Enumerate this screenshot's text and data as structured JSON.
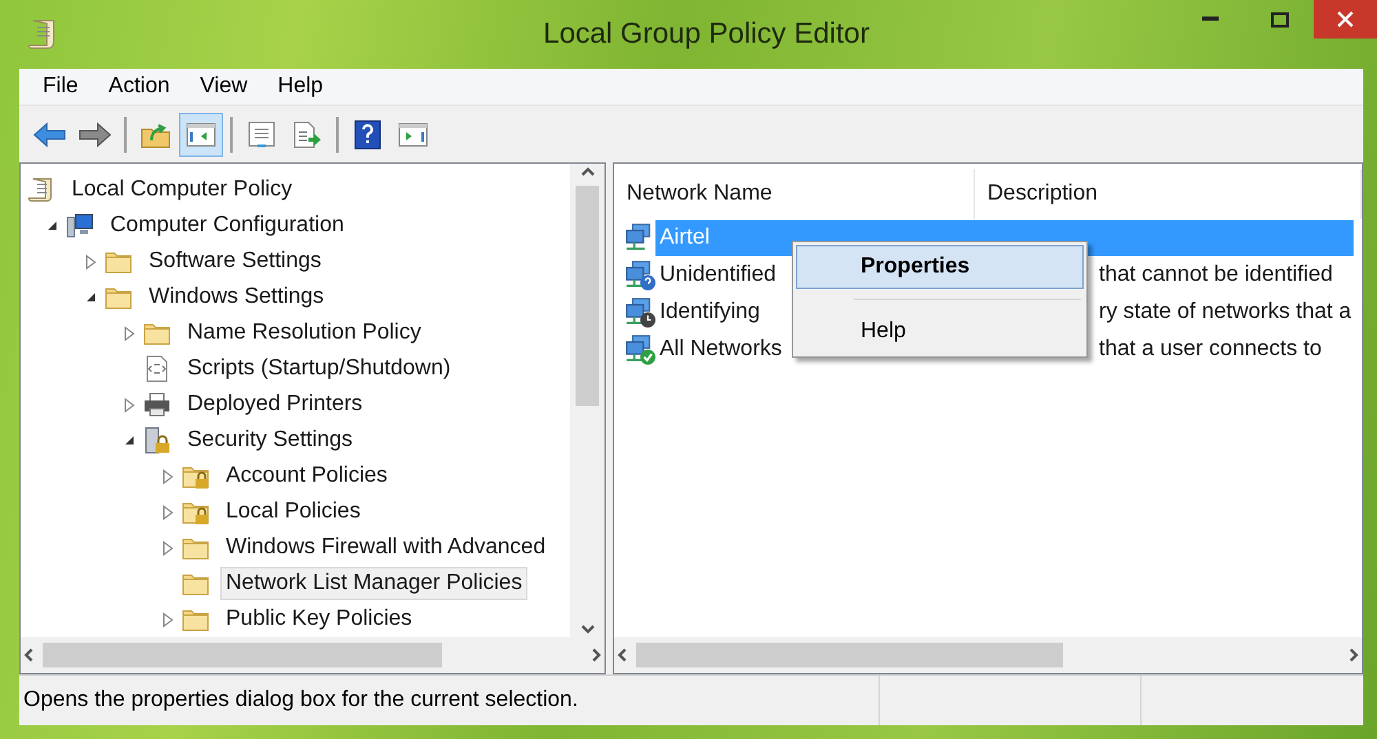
{
  "window": {
    "title": "Local Group Policy Editor"
  },
  "menu": [
    "File",
    "Action",
    "View",
    "Help"
  ],
  "toolbar": [
    [
      {
        "pressed": false
      },
      {
        "pressed": false
      }
    ],
    [
      {
        "pressed": false
      },
      {
        "pressed": true
      }
    ],
    [
      {
        "pressed": false
      },
      {
        "pressed": false
      }
    ],
    [
      {
        "pressed": false
      },
      {
        "pressed": false
      }
    ]
  ],
  "tree": [
    {
      "label": "Local Computer Policy",
      "kind": "scroll",
      "selected": false,
      "children": [
        {
          "label": "Computer Configuration",
          "kind": "computer",
          "expanded": true,
          "selected": false,
          "children": [
            {
              "label": "Software Settings",
              "kind": "folder",
              "expanded": false,
              "selected": false
            },
            {
              "label": "Windows Settings",
              "kind": "folder",
              "expanded": true,
              "selected": false,
              "children": [
                {
                  "label": "Name Resolution Policy",
                  "kind": "folder",
                  "expanded": false,
                  "selected": false
                },
                {
                  "label": "Scripts (Startup/Shutdown)",
                  "kind": "script",
                  "selected": false
                },
                {
                  "label": "Deployed Printers",
                  "kind": "printer",
                  "expanded": false,
                  "selected": false
                },
                {
                  "label": "Security Settings",
                  "kind": "security",
                  "expanded": true,
                  "selected": false,
                  "children": [
                    {
                      "label": "Account Policies",
                      "kind": "locked-folder",
                      "expanded": false,
                      "selected": false
                    },
                    {
                      "label": "Local Policies",
                      "kind": "locked-folder",
                      "expanded": false,
                      "selected": false
                    },
                    {
                      "label": "Windows Firewall with Advanced",
                      "kind": "folder",
                      "expanded": false,
                      "selected": false
                    },
                    {
                      "label": "Network List Manager Policies",
                      "kind": "folder",
                      "selected": true
                    },
                    {
                      "label": "Public Key Policies",
                      "kind": "folder",
                      "expanded": false,
                      "selected": false
                    }
                  ]
                }
              ]
            }
          ]
        }
      ]
    }
  ],
  "list": {
    "columns": [
      "Network Name",
      "Description"
    ],
    "rows": [
      {
        "name": "Airtel",
        "kind": "plain",
        "selected": true
      },
      {
        "name": "Unidentified",
        "description": "that cannot be identified",
        "kind": "unknown",
        "selected": false,
        "covered": true
      },
      {
        "name": "Identifying",
        "description": "ry state of networks that a",
        "kind": "pending",
        "selected": false,
        "covered": true
      },
      {
        "name": "All Networks",
        "description": "that a user connects to",
        "kind": "ok",
        "selected": false,
        "covered": true
      }
    ]
  },
  "context_menu": [
    {
      "label": "Properties",
      "default": true,
      "highlighted": true
    },
    {
      "label": "Help",
      "default": false,
      "highlighted": false
    }
  ],
  "status_bar": "Opens the properties dialog box for the current selection."
}
